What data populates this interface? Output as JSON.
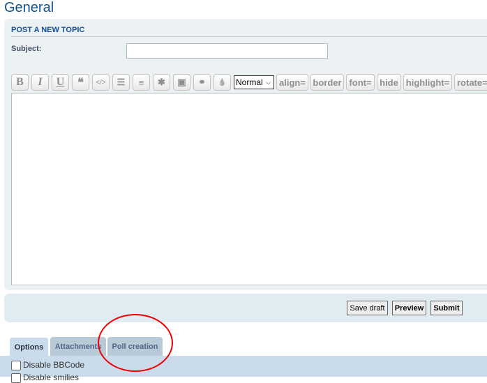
{
  "page_title": "General",
  "form": {
    "heading": "POST A NEW TOPIC",
    "subject_label": "Subject:",
    "subject_value": ""
  },
  "toolbar": {
    "buttons": [
      "B",
      "I",
      "U",
      "❝",
      "</>",
      "☰",
      "≡",
      "✱",
      "▣",
      "⚭",
      "💧"
    ],
    "font_size": "Normal",
    "extra": [
      "align=",
      "border",
      "font=",
      "hide",
      "highlight=",
      "rotate="
    ]
  },
  "actions": {
    "save_draft": "Save draft",
    "preview": "Preview",
    "submit": "Submit"
  },
  "tabs": [
    "Options",
    "Attachments",
    "Poll creation"
  ],
  "options": [
    "Disable BBCode",
    "Disable smilies"
  ],
  "annotation_color": "#e00000"
}
